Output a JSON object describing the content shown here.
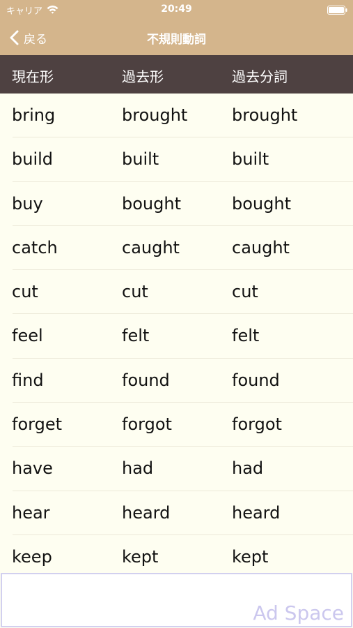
{
  "status_bar": {
    "carrier": "キャリア",
    "time": "20:49"
  },
  "nav": {
    "back_label": "戻る",
    "title": "不規則動詞"
  },
  "table": {
    "headers": [
      "現在形",
      "過去形",
      "過去分詞"
    ],
    "rows": [
      [
        "bring",
        "brought",
        "brought"
      ],
      [
        "build",
        "built",
        "built"
      ],
      [
        "buy",
        "bought",
        "bought"
      ],
      [
        "catch",
        "caught",
        "caught"
      ],
      [
        "cut",
        "cut",
        "cut"
      ],
      [
        "feel",
        "felt",
        "felt"
      ],
      [
        "find",
        "found",
        "found"
      ],
      [
        "forget",
        "forgot",
        "forgot"
      ],
      [
        "have",
        "had",
        "had"
      ],
      [
        "hear",
        "heard",
        "heard"
      ],
      [
        "keep",
        "kept",
        "kept"
      ]
    ]
  },
  "ad": {
    "label": "Ad Space"
  },
  "icons": {
    "wifi": "wifi-icon",
    "battery": "battery-icon",
    "back": "chevron-left-icon"
  },
  "colors": {
    "nav_background": "#d4b58c",
    "header_background": "#4e4141",
    "list_background": "#fefef1",
    "ad_border": "#d2d0ef",
    "ad_text": "#cbc7ee"
  }
}
